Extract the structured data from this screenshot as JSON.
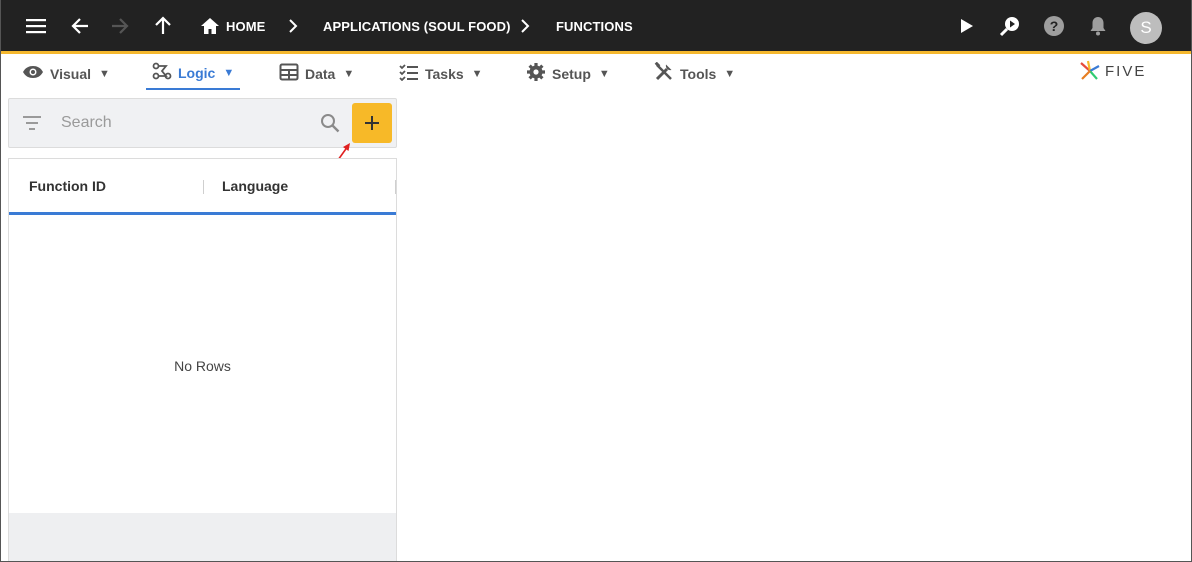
{
  "topbar": {
    "breadcrumbs": [
      {
        "label": "HOME"
      },
      {
        "label": "APPLICATIONS (SOUL FOOD)"
      },
      {
        "label": "FUNCTIONS"
      }
    ],
    "user_initial": "S",
    "icons": [
      "menu-icon",
      "back-arrow-icon",
      "forward-arrow-icon",
      "up-arrow-icon",
      "home-icon",
      "chevron-right-icon",
      "play-icon",
      "search-run-icon",
      "help-icon",
      "bell-icon"
    ]
  },
  "menubar": {
    "items": [
      {
        "label": "Visual",
        "icon": "eye-icon",
        "active": false
      },
      {
        "label": "Logic",
        "icon": "logic-flow-icon",
        "active": true
      },
      {
        "label": "Data",
        "icon": "table-icon",
        "active": false
      },
      {
        "label": "Tasks",
        "icon": "checklist-icon",
        "active": false
      },
      {
        "label": "Setup",
        "icon": "gear-icon",
        "active": false
      },
      {
        "label": "Tools",
        "icon": "tools-icon",
        "active": false
      }
    ],
    "caret": "▼",
    "logo_text": "FIVE"
  },
  "search": {
    "placeholder": "Search",
    "value": "",
    "add_label": "+"
  },
  "grid": {
    "columns": [
      "Function ID",
      "Language"
    ],
    "rows": [],
    "empty_message": "No Rows"
  },
  "colors": {
    "topbar_bg": "#222222",
    "accent_yellow": "#f7b928",
    "active_blue": "#3a7bd5",
    "annotation_red": "#e02020"
  }
}
